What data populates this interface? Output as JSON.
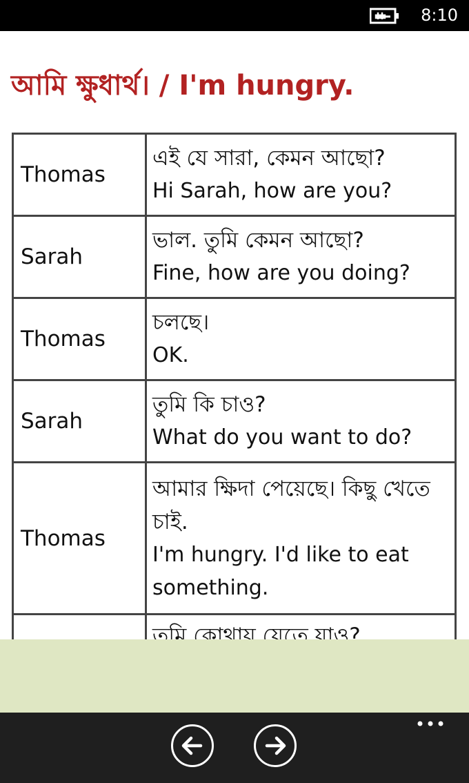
{
  "status_bar": {
    "time": "8:10",
    "battery_icon": "battery-charging-icon"
  },
  "page": {
    "title": "আমি ক্ষুধার্থ। / I'm hungry."
  },
  "dialogue": [
    {
      "speaker": "Thomas",
      "bengali": "এই যে সারা, কেমন আছো?",
      "english": "Hi Sarah, how are you?"
    },
    {
      "speaker": "Sarah",
      "bengali": "ভাল. তুমি কেমন আছো?",
      "english": "Fine, how are you doing?"
    },
    {
      "speaker": "Thomas",
      "bengali": "চলছে।",
      "english": "OK."
    },
    {
      "speaker": "Sarah",
      "bengali": "তুমি কি চাও?",
      "english": "What do you want to do?"
    },
    {
      "speaker": "Thomas",
      "bengali": "আমার ক্ষিদা পেয়েছে। কিছু খেতে চাই.",
      "english": "I'm hungry. I'd like to eat something."
    },
    {
      "speaker": "",
      "bengali": "তুমি কোথায় যেতে যাও?",
      "english": ""
    }
  ],
  "app_bar": {
    "back_icon": "arrow-left-icon",
    "forward_icon": "arrow-right-icon",
    "more_icon": "ellipsis-icon"
  },
  "colors": {
    "title": "#b22222",
    "ad_banner": "#dfe7c3",
    "app_bar": "#1f1f1f",
    "status_bar": "#000000"
  }
}
